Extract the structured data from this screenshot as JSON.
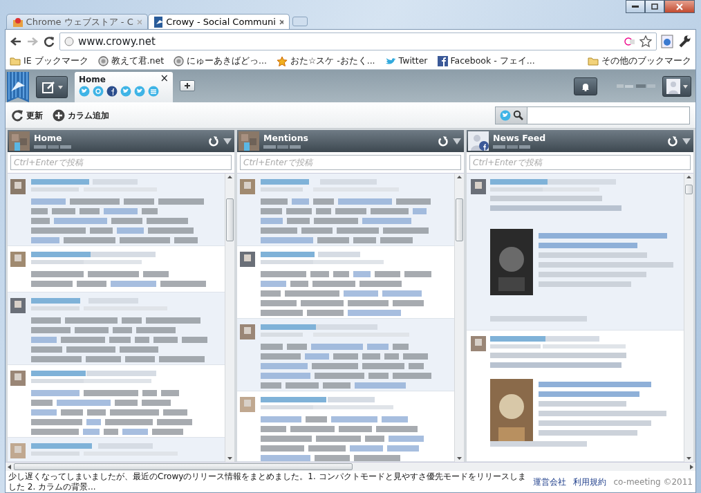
{
  "browser": {
    "tabs": [
      {
        "title": "Chrome ウェブストア - C",
        "kind": "store",
        "selected": false
      },
      {
        "title": "Crowy - Social Communi",
        "kind": "crowy",
        "selected": true
      }
    ],
    "address": "www.crowy.net",
    "bookmarks": [
      {
        "kind": "folder",
        "label": "IE ブックマーク"
      },
      {
        "kind": "globe",
        "label": "教えて君.net"
      },
      {
        "kind": "globe",
        "label": "にゅーあきばどっ..."
      },
      {
        "kind": "star",
        "label": "おた☆スケ -おたく..."
      },
      {
        "kind": "bird",
        "label": "Twitter"
      },
      {
        "kind": "facebook",
        "label": "Facebook - フェイ..."
      }
    ],
    "other_bookmarks": "その他のブックマーク"
  },
  "app": {
    "tab": {
      "label": "Home",
      "close": "×",
      "selected": true,
      "services": [
        {
          "kind": "twitter"
        },
        {
          "kind": "mention"
        },
        {
          "kind": "facebook"
        },
        {
          "kind": "twitter"
        },
        {
          "kind": "twitter"
        },
        {
          "kind": "list"
        }
      ]
    },
    "toolbar": [
      {
        "kind": "refresh",
        "label": "更新"
      },
      {
        "kind": "add",
        "label": "カラム追加"
      }
    ],
    "columns": [
      {
        "title": "Home",
        "kind": "twitter",
        "placeholder": "Ctrl+Enterで投稿",
        "posts": [
          {
            "kind": "long",
            "unread": true
          },
          {
            "kind": "short",
            "unread": false
          },
          {
            "kind": "long",
            "unread": true
          },
          {
            "kind": "long",
            "unread": false
          },
          {
            "kind": "short",
            "unread": true
          }
        ]
      },
      {
        "title": "Mentions",
        "kind": "twitter",
        "placeholder": "Ctrl+Enterで投稿",
        "posts": [
          {
            "kind": "long",
            "unread": true
          },
          {
            "kind": "long",
            "unread": false
          },
          {
            "kind": "long",
            "unread": true
          },
          {
            "kind": "long",
            "unread": false
          }
        ]
      },
      {
        "title": "News Feed",
        "kind": "facebook",
        "placeholder": "Ctrl+Enterで投稿",
        "posts": [
          {
            "kind": "photo",
            "unread": true
          },
          {
            "kind": "photo",
            "unread": false
          }
        ]
      }
    ],
    "status_bar": {
      "news": "少し遅くなってしまいましたが、最近のCrowyのリリース情報をまとめました。1. コンパクトモードと見やすさ優先モードをリリースしました 2. カラムの背景...",
      "links": [
        "運営会社",
        "利用規約"
      ],
      "copyright": "co-meeting ©2011"
    }
  }
}
